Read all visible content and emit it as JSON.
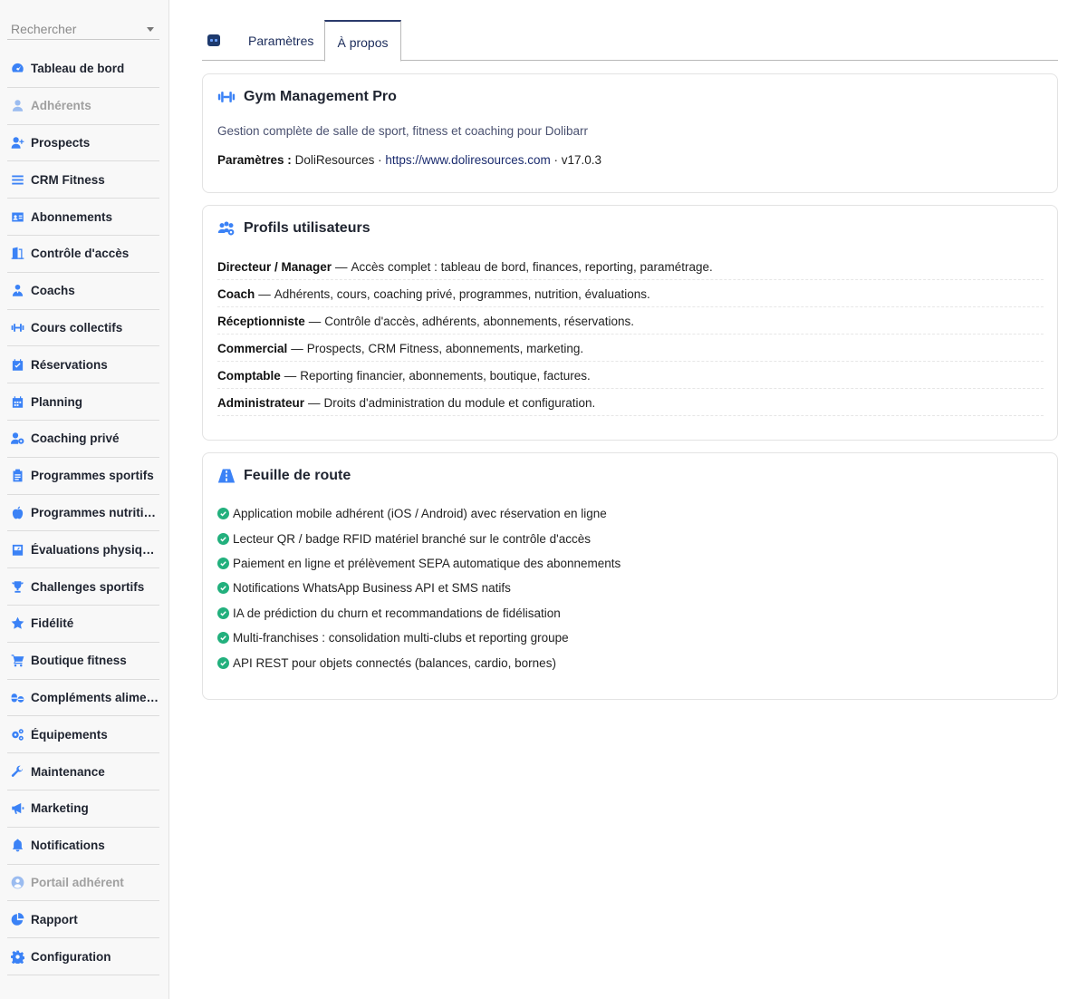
{
  "search": {
    "placeholder": "Rechercher"
  },
  "sidebar": {
    "items": [
      {
        "label": "Tableau de bord",
        "icon": "gauge-icon",
        "disabled": false
      },
      {
        "label": "Adhérents",
        "icon": "user-icon",
        "disabled": true
      },
      {
        "label": "Prospects",
        "icon": "user-plus-icon",
        "disabled": false
      },
      {
        "label": "CRM Fitness",
        "icon": "list-icon",
        "disabled": false
      },
      {
        "label": "Abonnements",
        "icon": "id-card-icon",
        "disabled": false
      },
      {
        "label": "Contrôle d'accès",
        "icon": "door-icon",
        "disabled": false
      },
      {
        "label": "Coachs",
        "icon": "coach-icon",
        "disabled": false
      },
      {
        "label": "Cours collectifs",
        "icon": "dumbbell-icon",
        "disabled": false
      },
      {
        "label": "Réservations",
        "icon": "calendar-check-icon",
        "disabled": false
      },
      {
        "label": "Planning",
        "icon": "calendar-icon",
        "disabled": false
      },
      {
        "label": "Coaching privé",
        "icon": "user-gear-icon",
        "disabled": false
      },
      {
        "label": "Programmes sportifs",
        "icon": "clipboard-icon",
        "disabled": false
      },
      {
        "label": "Programmes nutritionnels",
        "icon": "apple-icon",
        "disabled": false
      },
      {
        "label": "Évaluations physiques",
        "icon": "scale-icon",
        "disabled": false
      },
      {
        "label": "Challenges sportifs",
        "icon": "trophy-icon",
        "disabled": false
      },
      {
        "label": "Fidélité",
        "icon": "star-icon",
        "disabled": false
      },
      {
        "label": "Boutique fitness",
        "icon": "cart-icon",
        "disabled": false
      },
      {
        "label": "Compléments alimentaires",
        "icon": "pills-icon",
        "disabled": false
      },
      {
        "label": "Équipements",
        "icon": "gears-icon",
        "disabled": false
      },
      {
        "label": "Maintenance",
        "icon": "wrench-icon",
        "disabled": false
      },
      {
        "label": "Marketing",
        "icon": "megaphone-icon",
        "disabled": false
      },
      {
        "label": "Notifications",
        "icon": "bell-icon",
        "disabled": false
      },
      {
        "label": "Portail adhérent",
        "icon": "user-circle-icon",
        "disabled": true
      },
      {
        "label": "Rapport",
        "icon": "pie-chart-icon",
        "disabled": false
      },
      {
        "label": "Configuration",
        "icon": "gear-icon",
        "disabled": false
      }
    ]
  },
  "tabs": {
    "params_label": "Paramètres",
    "apropos_label": "À propos",
    "active": "À propos"
  },
  "about": {
    "title": "Gym Management Pro",
    "description": "Gestion complète de salle de sport, fitness et coaching pour Dolibarr",
    "params_label": "Paramètres :",
    "publisher": "DoliResources",
    "separator": "·",
    "url": "https://www.doliresources.com",
    "version": "v17.0.3"
  },
  "profiles": {
    "title": "Profils utilisateurs",
    "items": [
      {
        "role": "Directeur / Manager",
        "description": "Accès complet : tableau de bord, finances, reporting, paramétrage."
      },
      {
        "role": "Coach",
        "description": "Adhérents, cours, coaching privé, programmes, nutrition, évaluations."
      },
      {
        "role": "Réceptionniste",
        "description": "Contrôle d'accès, adhérents, abonnements, réservations."
      },
      {
        "role": "Commercial",
        "description": "Prospects, CRM Fitness, abonnements, marketing."
      },
      {
        "role": "Comptable",
        "description": "Reporting financier, abonnements, boutique, factures."
      },
      {
        "role": "Administrateur",
        "description": "Droits d'administration du module et configuration."
      }
    ],
    "dash": "—"
  },
  "roadmap": {
    "title": "Feuille de route",
    "items": [
      "Application mobile adhérent (iOS / Android) avec réservation en ligne",
      "Lecteur QR / badge RFID matériel branché sur le contrôle d'accès",
      "Paiement en ligne et prélèvement SEPA automatique des abonnements",
      "Notifications WhatsApp Business API et SMS natifs",
      "IA de prédiction du churn et recommandations de fidélisation",
      "Multi-franchises : consolidation multi-clubs et reporting groupe",
      "API REST pour objets connectés (balances, cardio, bornes)"
    ]
  },
  "colors": {
    "accent": "#3b82f6",
    "success": "#22b07d",
    "tab_active": "#2a3a6b"
  }
}
